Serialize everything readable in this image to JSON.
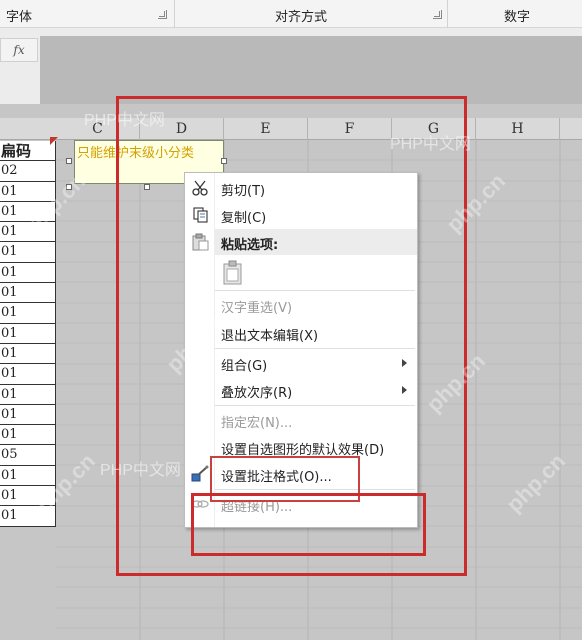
{
  "ribbon": {
    "groups": [
      {
        "label": "字体",
        "launcher": true
      },
      {
        "label": "对齐方式",
        "launcher": true
      },
      {
        "label": "数字",
        "launcher": false
      }
    ]
  },
  "formula_bar": {
    "fx_label": "fx"
  },
  "columns": [
    "C",
    "D",
    "E",
    "F",
    "G",
    "H"
  ],
  "b_column": [
    "扁码",
    "02",
    "01",
    "01",
    "01",
    "01",
    "01",
    "01",
    "01",
    "01",
    "01",
    "01",
    "01",
    "01",
    "01",
    "05",
    "01",
    "01",
    "01"
  ],
  "comment": {
    "text": "只能维护末级小分类"
  },
  "context_menu": {
    "items": [
      {
        "label": "剪切(T)",
        "icon": "scissors-icon",
        "disabled": false
      },
      {
        "label": "复制(C)",
        "icon": "copy-icon",
        "disabled": false
      },
      {
        "label": "粘贴选项:",
        "icon": "paste-icon",
        "disabled": false
      },
      {
        "label": "汉字重选(V)",
        "disabled": true
      },
      {
        "label": "退出文本编辑(X)",
        "disabled": false
      },
      {
        "label": "组合(G)",
        "disabled": false,
        "submenu": true
      },
      {
        "label": "叠放次序(R)",
        "disabled": false,
        "submenu": true
      },
      {
        "label": "指定宏(N)...",
        "disabled": true
      },
      {
        "label": "设置自选图形的默认效果(D)",
        "disabled": false
      },
      {
        "label": "设置批注格式(O)...",
        "icon": "format-brush-icon",
        "disabled": false
      },
      {
        "label": "超链接(H)...",
        "icon": "hyperlink-icon",
        "disabled": true
      }
    ]
  },
  "watermarks": {
    "site_text": "PHP中文网",
    "domain_text": "php.cn"
  },
  "colors": {
    "annotation_red": "#cc2b2b",
    "comment_bg": "#ffffe1",
    "comment_text": "#d4a100"
  }
}
